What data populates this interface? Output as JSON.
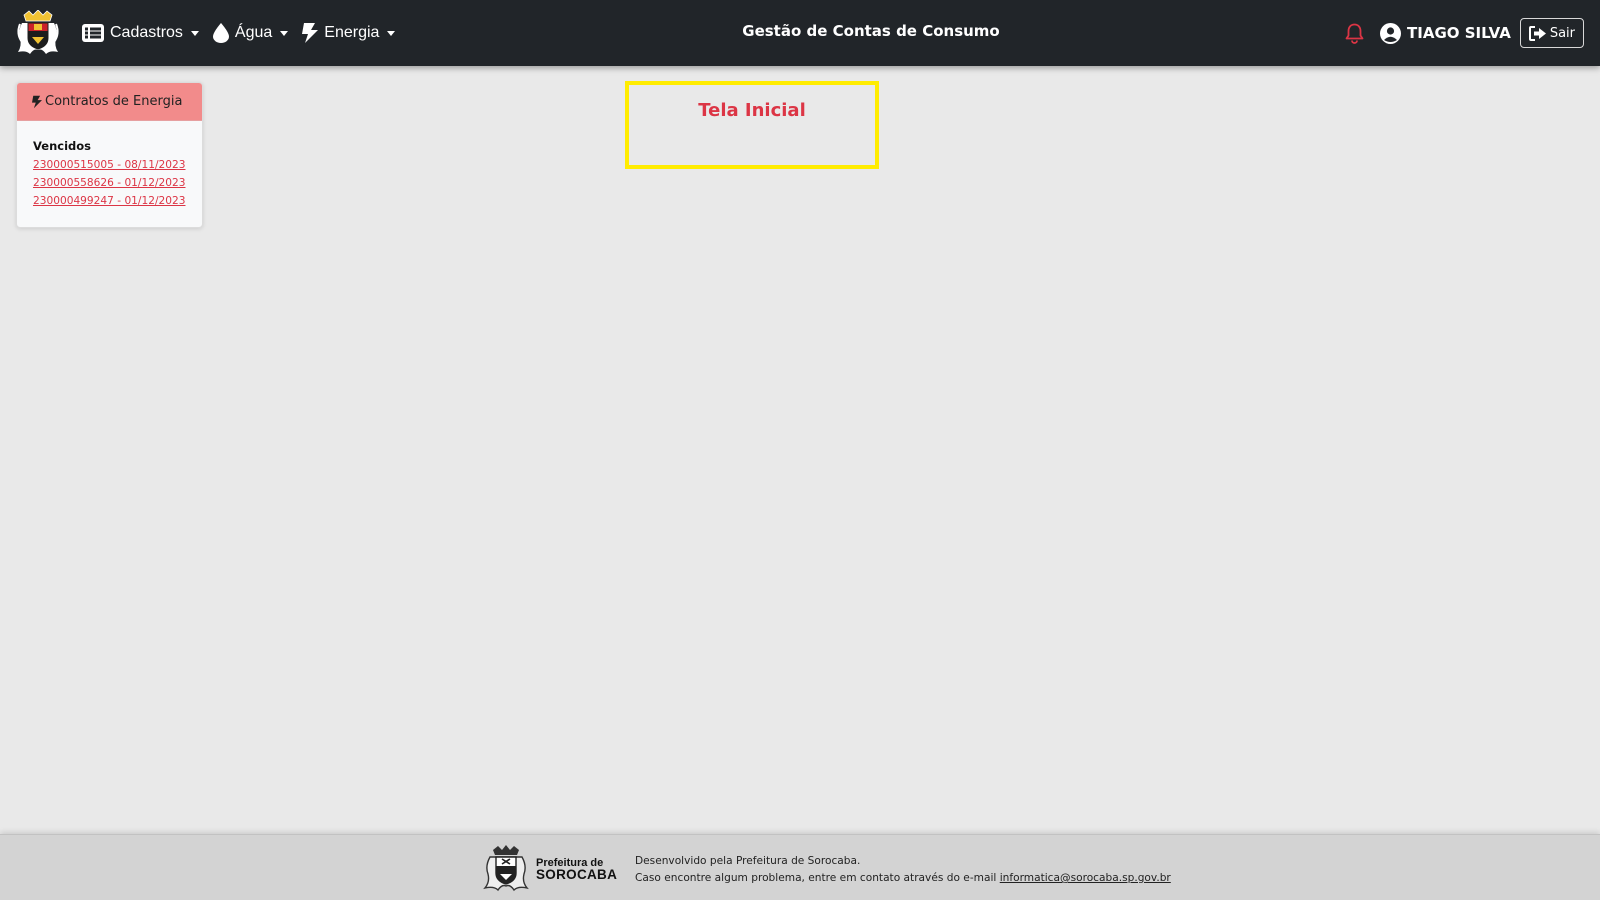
{
  "header": {
    "title": "Gestão de Contas de Consumo",
    "menu": [
      {
        "label": "Cadastros",
        "icon": "list-icon"
      },
      {
        "label": "Água",
        "icon": "water-drop-icon"
      },
      {
        "label": "Energia",
        "icon": "bolt-icon"
      }
    ],
    "user_name": "TIAGO SILVA",
    "logout_label": "Sair",
    "notification_color": "#dc3545"
  },
  "contracts_card": {
    "title": "Contratos de Energia",
    "section_label": "Vencidos",
    "items": [
      "230000515005 - 08/11/2023",
      "230000558626 - 01/12/2023",
      "230000499247 - 01/12/2023"
    ]
  },
  "main": {
    "title": "Tela Inicial"
  },
  "footer": {
    "org_line1": "Prefeitura de",
    "org_line2": "SOROCABA",
    "developed_by": "Desenvolvido pela Prefeitura de Sorocaba.",
    "contact_text": "Caso encontre algum problema, entre em contato através do e-mail",
    "contact_email": "informatica@sorocaba.sp.gov.br"
  },
  "colors": {
    "navbar": "#212529",
    "card_header": "#f28b8b",
    "link": "#dc3545",
    "highlight_border": "#ffec00",
    "footer": "#d3d3d3"
  }
}
